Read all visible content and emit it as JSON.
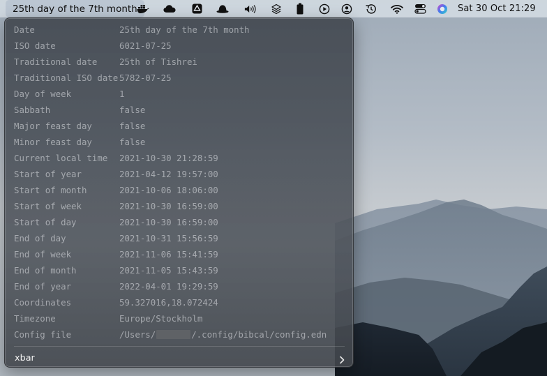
{
  "menubar": {
    "title": "25th day of the 7th month",
    "clock": "Sat 30 Oct  21:29",
    "icons": [
      "docker-icon",
      "cloud-icon",
      "google-drive-icon",
      "bowler-hat-icon",
      "volume-icon",
      "layers-icon",
      "battery-icon",
      "play-icon",
      "user-icon",
      "history-icon",
      "wifi-icon",
      "control-center-icon",
      "siri-icon"
    ]
  },
  "panel": {
    "rows": [
      {
        "key": "Date",
        "value": "25th day of the 7th month"
      },
      {
        "key": "ISO date",
        "value": "6021-07-25"
      },
      {
        "key": "Traditional date",
        "value": "25th of Tishrei"
      },
      {
        "key": "Traditional ISO date",
        "value": "5782-07-25"
      },
      {
        "key": "Day of week",
        "value": "1"
      },
      {
        "key": "Sabbath",
        "value": "false"
      },
      {
        "key": "Major feast day",
        "value": "false"
      },
      {
        "key": "Minor feast day",
        "value": "false"
      },
      {
        "key": "Current local time",
        "value": "2021-10-30 21:28:59"
      },
      {
        "key": "Start of year",
        "value": "2021-04-12 19:57:00"
      },
      {
        "key": "Start of month",
        "value": "2021-10-06 18:06:00"
      },
      {
        "key": "Start of week",
        "value": "2021-10-30 16:59:00"
      },
      {
        "key": "Start of day",
        "value": "2021-10-30 16:59:00"
      },
      {
        "key": "End of day",
        "value": "2021-10-31 15:56:59"
      },
      {
        "key": "End of week",
        "value": "2021-11-06 15:41:59"
      },
      {
        "key": "End of month",
        "value": "2021-11-05 15:43:59"
      },
      {
        "key": "End of year",
        "value": "2022-04-01 19:29:59"
      },
      {
        "key": "Coordinates",
        "value": "59.327016,18.072424"
      },
      {
        "key": "Timezone",
        "value": "Europe/Stockholm"
      }
    ],
    "config_row": {
      "key": "Config file",
      "value_prefix": "/Users/",
      "value_suffix": "/.config/bibcal/config.edn"
    },
    "submenu_label": "xbar"
  }
}
